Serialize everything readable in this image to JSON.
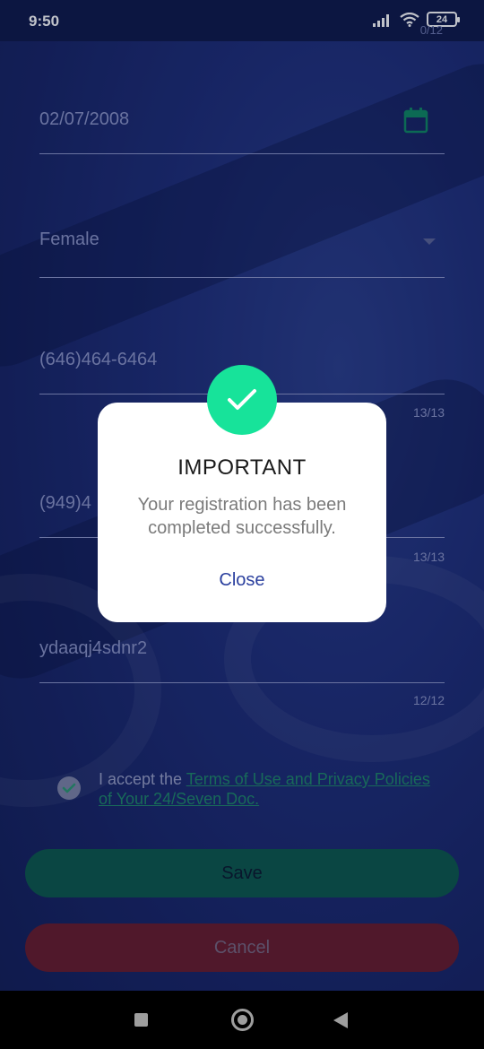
{
  "status_bar": {
    "time": "9:50",
    "battery": "24",
    "top_counter": "0/12"
  },
  "form": {
    "birth_date": "02/07/2008",
    "gender": "Female",
    "phone_primary": "(646)464-6464",
    "phone_primary_counter": "13/13",
    "phone_secondary": "(949)4",
    "phone_secondary_counter": "13/13",
    "password": "ydaaqj4sdnr2",
    "password_counter": "12/12",
    "terms_prefix": "I accept the ",
    "terms_link": "Terms of Use and Privacy Policies of Your 24/Seven Doc.",
    "terms_checked": true
  },
  "buttons": {
    "save": "Save",
    "cancel": "Cancel"
  },
  "dialog": {
    "title": "IMPORTANT",
    "message": "Your registration has been completed successfully.",
    "close": "Close",
    "badge_icon": "checkmark-icon"
  },
  "colors": {
    "accent_green": "#17e39a",
    "save_button": "#0c5a4c",
    "cancel_button": "#6a1c2c",
    "link_blue": "#2a3f9e"
  }
}
